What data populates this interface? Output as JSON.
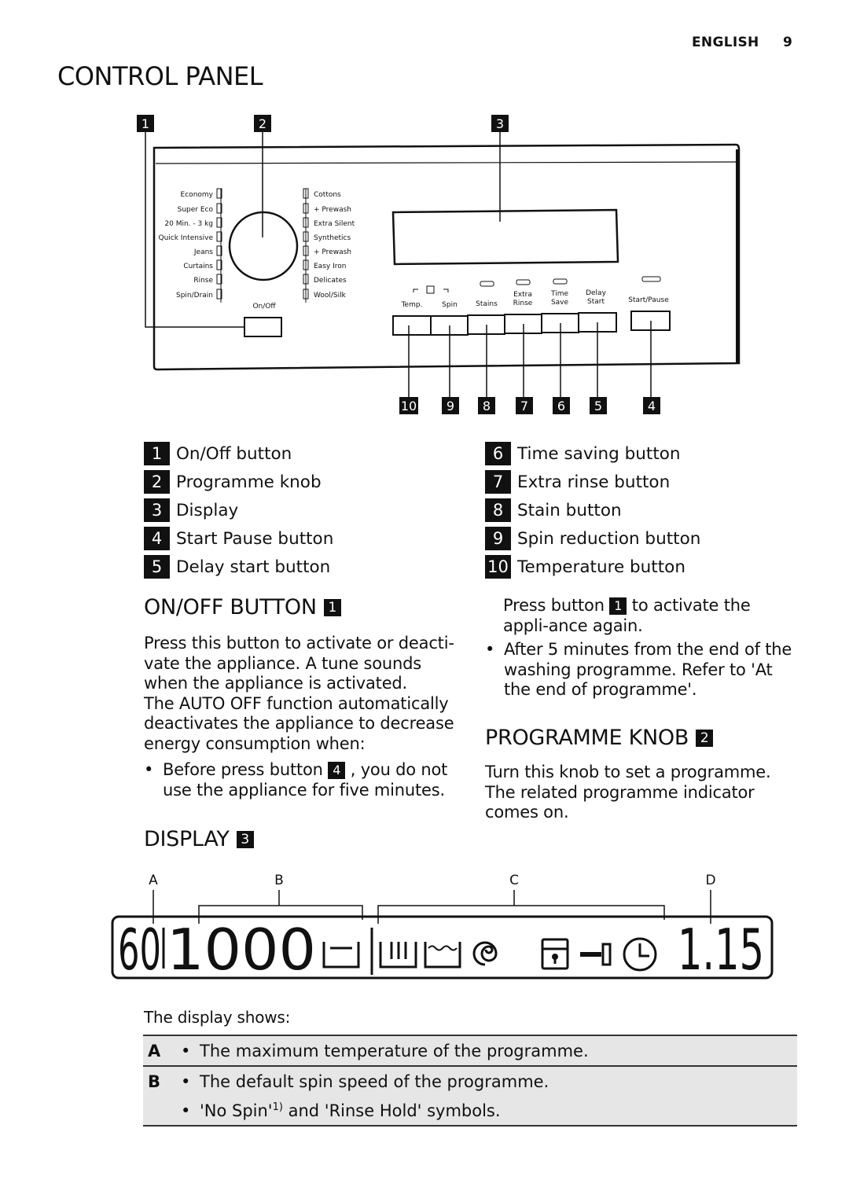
{
  "header": {
    "language": "ENGLISH",
    "page_number": "9"
  },
  "title": "CONTROL PANEL",
  "diagram": {
    "callouts_top": [
      "1",
      "2",
      "3"
    ],
    "callouts_bottom": [
      "10",
      "9",
      "8",
      "7",
      "6",
      "5",
      "4"
    ],
    "programmes_left": [
      "Economy",
      "Super Eco",
      "20 Min. - 3 kg",
      "Quick Intensive",
      "Jeans",
      "Curtains",
      "Rinse",
      "Spin/Drain"
    ],
    "programmes_right": [
      "Cottons",
      "+ Prewash",
      "Extra Silent",
      "Synthetics",
      "+ Prewash",
      "Easy Iron",
      "Delicates",
      "Wool/Silk"
    ],
    "on_off_label": "On/Off",
    "button_labels": {
      "temp": "Temp.",
      "spin": "Spin",
      "stains": "Stains",
      "extra1": "Extra",
      "extra2": "Rinse",
      "time1": "Time",
      "time2": "Save",
      "delay1": "Delay",
      "delay2": "Start",
      "start_pause": "Start/Pause"
    }
  },
  "legend": {
    "left": [
      {
        "n": "1",
        "label": "On/Off button"
      },
      {
        "n": "2",
        "label": "Programme knob"
      },
      {
        "n": "3",
        "label": "Display"
      },
      {
        "n": "4",
        "label": "Start Pause button"
      },
      {
        "n": "5",
        "label": "Delay start button"
      }
    ],
    "right": [
      {
        "n": "6",
        "label": "Time saving button"
      },
      {
        "n": "7",
        "label": "Extra rinse button"
      },
      {
        "n": "8",
        "label": "Stain button"
      },
      {
        "n": "9",
        "label": "Spin reduction button"
      },
      {
        "n": "10",
        "label": "Temperature button"
      }
    ]
  },
  "onoff": {
    "heading": "ON/OFF BUTTON",
    "ref": "1",
    "p1": "Press this button to activate or deacti-vate the appliance. A tune sounds when the appliance is activated.",
    "p2": "The AUTO OFF function automatically deactivates the appliance to decrease energy consumption when:",
    "b1_pre": "Before press button",
    "b1_ref": "4",
    "b1_post": ", you do not use the appliance for five minutes.",
    "r1_pre": "Press button",
    "r1_ref": "1",
    "r1_post": "to activate the appli-ance again.",
    "b2": "After 5 minutes from the end of the washing programme. Refer to 'At the end of programme'."
  },
  "knob": {
    "heading": "PROGRAMME KNOB",
    "ref": "2",
    "p": "Turn this knob to set a programme. The related programme indicator comes on."
  },
  "display": {
    "heading": "DISPLAY",
    "ref": "3",
    "letters": [
      "A",
      "B",
      "C",
      "D"
    ],
    "temp": "60",
    "spin": "1000",
    "time": "1.15",
    "shows_label": "The display shows:",
    "rows": [
      {
        "key": "A",
        "items": [
          "The maximum temperature of the programme."
        ]
      },
      {
        "key": "B",
        "items": [
          "The default spin speed of the programme.",
          "'No Spin'"
        ],
        "sup": "1)",
        "tail": " and 'Rinse Hold' symbols."
      }
    ]
  }
}
